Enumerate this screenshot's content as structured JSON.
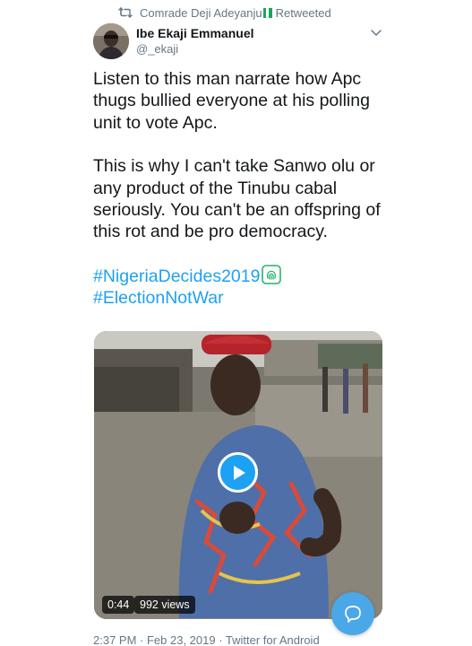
{
  "retweet": {
    "user": "Comrade Deji Adeyanju",
    "label": "Retweeted",
    "icon": "retweet-icon",
    "flag_colors": [
      "#1da35a",
      "#ffffff",
      "#1da35a"
    ]
  },
  "tweet": {
    "author_name": "Ibe Ekaji Emmanuel",
    "author_handle": "@_ekaji",
    "lines_p1": [
      "Listen to this man narrate how Apc",
      "thugs bullied everyone at his polling",
      "unit to vote Apc."
    ],
    "lines_p2": [
      "This is why I can't take Sanwo olu or",
      "any product of the Tinubu cabal",
      "seriously. You can't be an offspring of",
      "this rot and be pro democracy."
    ],
    "hashtags": [
      "#NigeriaDecides2019",
      "#ElectionNotWar"
    ],
    "hashtag_emoji": "fingerprint-emoji-icon"
  },
  "video": {
    "duration": "0:44",
    "views": "992 views",
    "play_icon": "play-icon"
  },
  "meta": {
    "time": "2:37 PM",
    "separator": "·",
    "date": "Feb 23, 2019",
    "source": "Twitter for Android",
    "text": "2:37 PM · Feb 23, 2019 · Twitter for Android"
  },
  "fab": {
    "icon": "compose-reply-icon"
  },
  "colors": {
    "accent": "#1da1f2",
    "secondary_text": "#657786",
    "primary_text": "#14171a"
  }
}
